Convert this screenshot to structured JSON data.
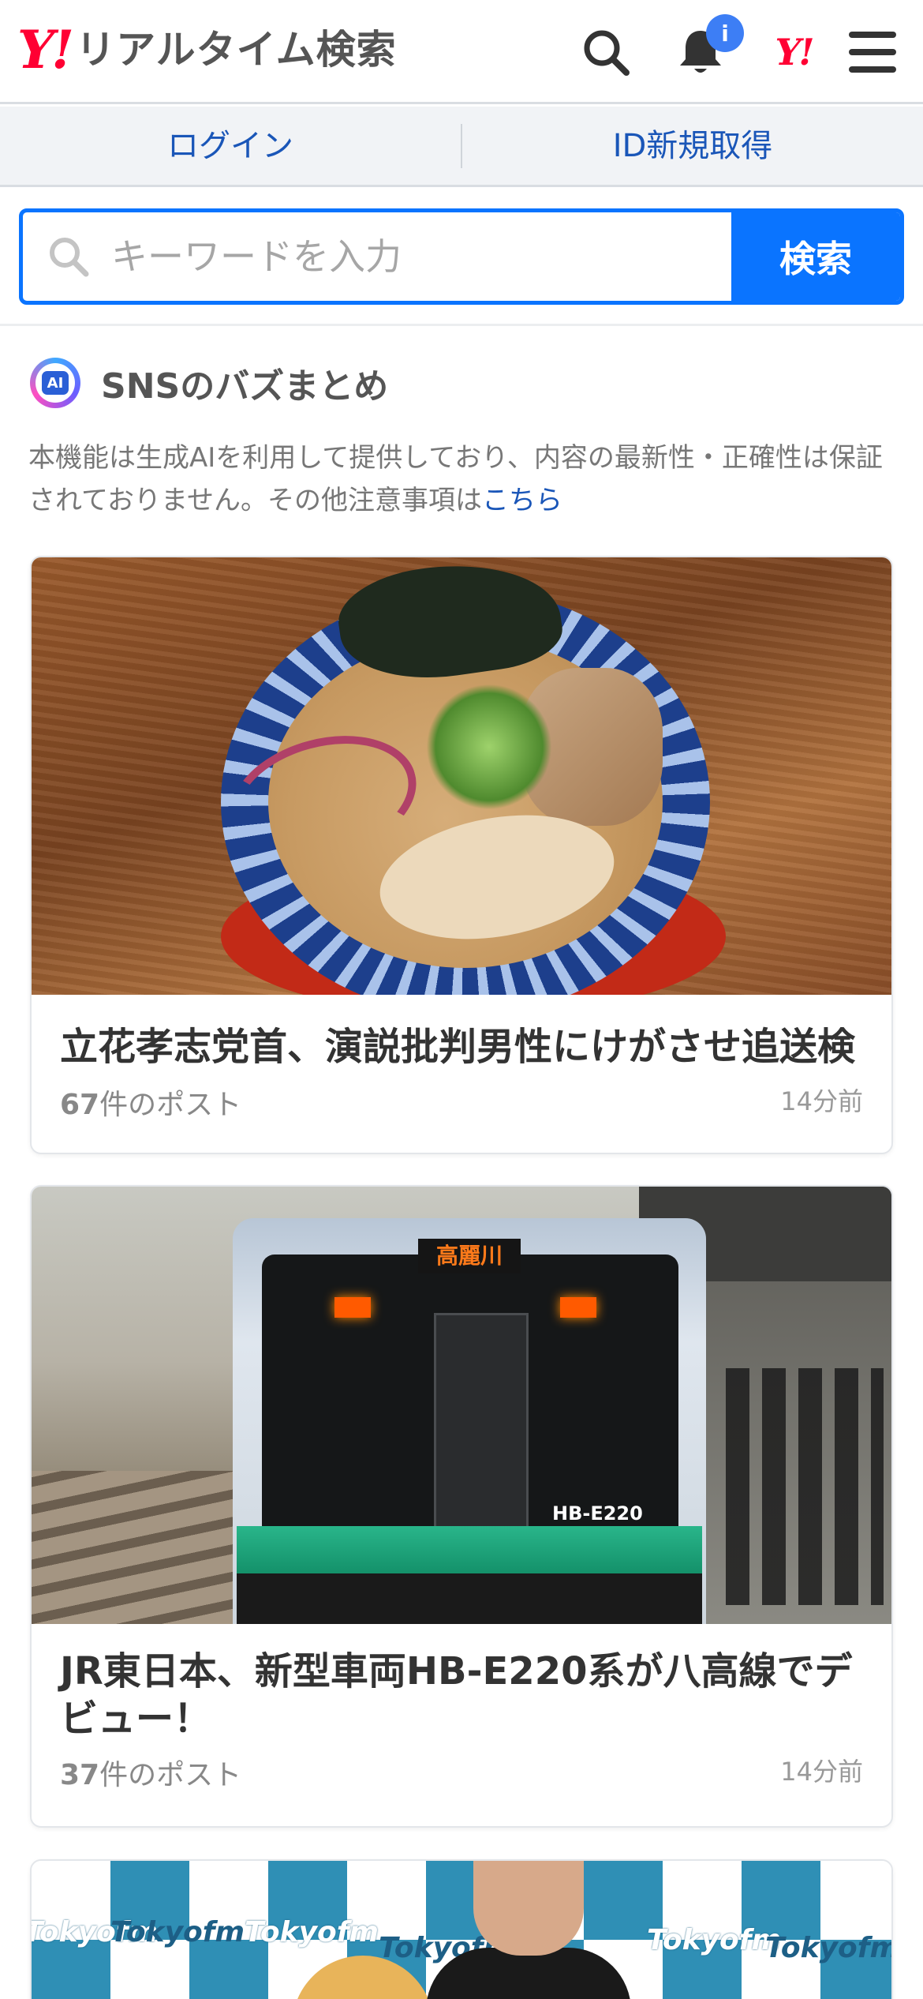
{
  "header": {
    "logo_y": "Y!",
    "logo_text": "リアルタイム検索",
    "notification_badge": "i",
    "yj_logo": "Y!"
  },
  "auth": {
    "login_label": "ログイン",
    "signup_label": "ID新規取得"
  },
  "search": {
    "placeholder": "キーワードを入力",
    "button_label": "検索"
  },
  "section": {
    "ai_chip": "AI",
    "title": "SNSのバズまとめ",
    "notice_text": "本機能は生成AIを利用して提供しており、内容の最新性・正確性は保証されておりません。その他注意事項は",
    "notice_link": "こちら"
  },
  "cards": [
    {
      "title": "立花孝志党首、演説批判男性にけがさせ追送検",
      "count": "67",
      "count_suffix": "件のポスト",
      "time": "14分前",
      "image": "ramen-bowl-photo"
    },
    {
      "title": "JR東日本、新型車両HB-E220系が八高線でデビュー！",
      "count": "37",
      "count_suffix": "件のポスト",
      "time": "14分前",
      "image": "train-photo",
      "destination_sign": "高麗川",
      "train_number": "HB-E220"
    },
    {
      "image": "tokyofm-studio-photo",
      "backdrop_logo": "Tokyofm"
    }
  ],
  "colors": {
    "brand_red": "#ff0033",
    "accent_blue": "#0a74ff",
    "link_blue": "#1a56b8",
    "badge_blue": "#3d7ef5"
  }
}
